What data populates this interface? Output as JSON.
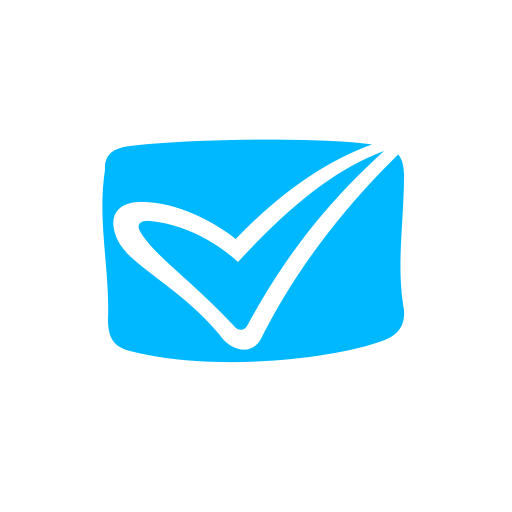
{
  "icon": {
    "name": "check-tv-icon",
    "background_color": "#ffffff",
    "shape_color": "#00b8ff",
    "check_color": "#ffffff"
  }
}
